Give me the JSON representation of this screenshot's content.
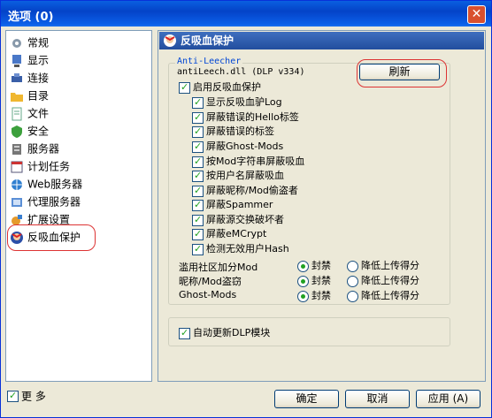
{
  "window": {
    "title": "选项 (0)",
    "close_label": "✕"
  },
  "sidebar": {
    "items": [
      {
        "label": "常规",
        "icon": "gear-icon"
      },
      {
        "label": "显示",
        "icon": "monitor-icon"
      },
      {
        "label": "连接",
        "icon": "connection-icon"
      },
      {
        "label": "目录",
        "icon": "folder-icon"
      },
      {
        "label": "文件",
        "icon": "file-icon"
      },
      {
        "label": "安全",
        "icon": "shield-icon"
      },
      {
        "label": "服务器",
        "icon": "server-icon"
      },
      {
        "label": "计划任务",
        "icon": "calendar-icon"
      },
      {
        "label": "Web服务器",
        "icon": "web-icon"
      },
      {
        "label": "代理服务器",
        "icon": "proxy-icon"
      },
      {
        "label": "扩展设置",
        "icon": "extension-icon"
      },
      {
        "label": "反吸血保护",
        "icon": "antileech-icon"
      }
    ]
  },
  "panel": {
    "title": "反吸血保护",
    "group_legend": "Anti-Leecher",
    "version": "antiLeech.dll (DLP v334)",
    "refresh_label": "刷新",
    "enable_label": "启用反吸血保护",
    "options": [
      "显示反吸血驴Log",
      "屏蔽错误的Hello标签",
      "屏蔽错误的标签",
      "屏蔽Ghost-Mods",
      "按Mod字符串屏蔽吸血",
      "按用户名屏蔽吸血",
      "屏蔽昵称/Mod偷盗者",
      "屏蔽Spammer",
      "屏蔽源交换破坏者",
      "屏蔽eMCrypt",
      "检测无效用户Hash"
    ],
    "radio_rows": [
      {
        "label": "滥用社区加分Mod",
        "ban": "封禁",
        "lower": "降低上传得分"
      },
      {
        "label": "昵称/Mod盗窃",
        "ban": "封禁",
        "lower": "降低上传得分"
      },
      {
        "label": "Ghost-Mods",
        "ban": "封禁",
        "lower": "降低上传得分"
      }
    ],
    "auto_update_label": "自动更新DLP模块"
  },
  "footer": {
    "more_label": "更 多",
    "ok_label": "确定",
    "cancel_label": "取消",
    "apply_label": "应用 (A)"
  }
}
